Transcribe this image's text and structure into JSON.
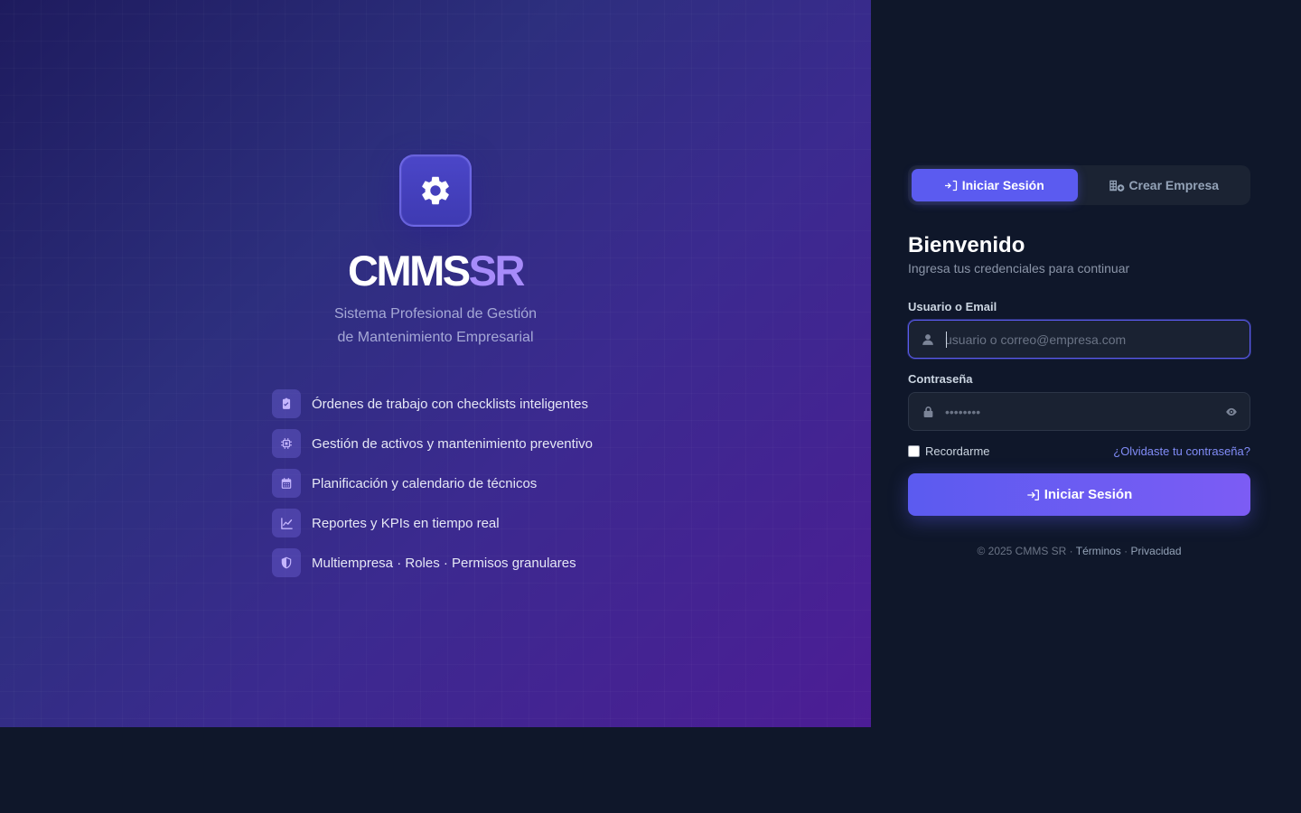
{
  "hero": {
    "brand_main": "CMMS",
    "brand_accent": "SR",
    "tagline_line1": "Sistema Profesional de Gestión",
    "tagline_line2": "de Mantenimiento Empresarial",
    "features": [
      {
        "icon": "clipboard-check-icon",
        "label": "Órdenes de trabajo con checklists inteligentes"
      },
      {
        "icon": "chip-icon",
        "label": "Gestión de activos y mantenimiento preventivo"
      },
      {
        "icon": "calendar-icon",
        "label": "Planificación y calendario de técnicos"
      },
      {
        "icon": "line-chart-icon",
        "label": "Reportes y KPIs en tiempo real"
      },
      {
        "icon": "shield-icon",
        "label": "Multiempresa · Roles · Permisos granulares"
      }
    ]
  },
  "auth": {
    "tabs": [
      {
        "label": "Iniciar Sesión",
        "icon": "sign-in-icon",
        "active": true
      },
      {
        "label": "Crear Empresa",
        "icon": "building-add-icon",
        "active": false
      }
    ],
    "title": "Bienvenido",
    "subtitle": "Ingresa tus credenciales para continuar",
    "username": {
      "label": "Usuario o Email",
      "placeholder": "usuario o correo@empresa.com",
      "value": ""
    },
    "password": {
      "label": "Contraseña",
      "placeholder": "••••••••",
      "value": ""
    },
    "remember_label": "Recordarme",
    "remember_checked": false,
    "forgot_label": "¿Olvidaste tu contraseña?",
    "submit_label": "Iniciar Sesión",
    "footer": {
      "copyright": "© 2025 CMMS SR · ",
      "terms": "Términos",
      "sep": " · ",
      "privacy": "Privacidad"
    }
  },
  "colors": {
    "accent": "#5b5bf0",
    "accent_light": "#a78bfa",
    "background": "#0f172a",
    "link": "#818cf8"
  }
}
